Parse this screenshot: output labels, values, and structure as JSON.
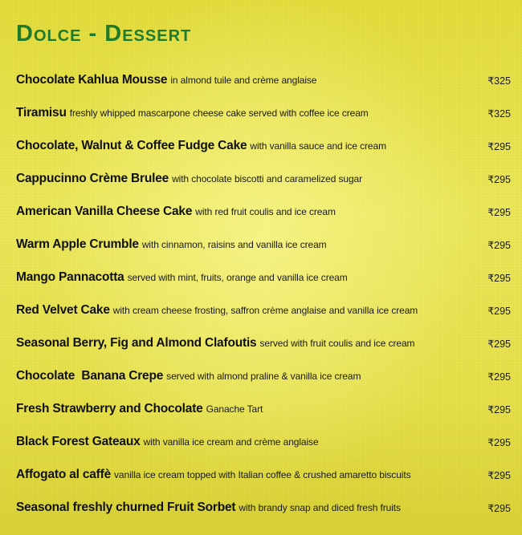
{
  "menu": {
    "title": "Dolce - Dessert",
    "items": [
      {
        "name": "Chocolate Kahlua Mousse",
        "description": "in almond tuile and crème anglaise",
        "price": "₹325"
      },
      {
        "name": "Tiramisu",
        "description": "freshly whipped mascarpone cheese cake served with coffee ice cream",
        "price": "₹325"
      },
      {
        "name": "Chocolate, Walnut & Coffee Fudge Cake",
        "description": "with vanilla sauce and ice cream",
        "price": "₹295"
      },
      {
        "name": "Cappucinno Crème Brulee",
        "description": "with chocolate biscotti and caramelized sugar",
        "price": "₹295"
      },
      {
        "name": "American Vanilla Cheese Cake",
        "description": "with red fruit coulis and ice cream",
        "price": "₹295"
      },
      {
        "name": "Warm Apple Crumble",
        "description": "with cinnamon, raisins and vanilla ice cream",
        "price": "₹295"
      },
      {
        "name": "Mango Pannacotta",
        "description": "served with mint, fruits, orange and vanilla ice cream",
        "price": "₹295"
      },
      {
        "name": "Red Velvet Cake",
        "description": "with cream cheese frosting, saffron crème anglaise and vanilla ice cream",
        "price": "₹295"
      },
      {
        "name": "Seasonal Berry, Fig and Almond Clafoutis",
        "description": "served with fruit coulis and ice cream",
        "price": "₹295"
      },
      {
        "name": "Chocolate  Banana Crepe",
        "description": "served with almond praline & vanilla ice cream",
        "price": "₹295"
      },
      {
        "name": "Fresh Strawberry and Chocolate",
        "description": "Ganache Tart",
        "price": "₹295"
      },
      {
        "name": "Black Forest Gateaux",
        "description": "with vanilla ice cream and crème anglaise",
        "price": "₹295"
      },
      {
        "name": "Affogato al caffè",
        "description": "vanilla ice cream topped with Italian coffee & crushed amaretto biscuits",
        "price": "₹295"
      },
      {
        "name": "Seasonal freshly churned Fruit Sorbet",
        "description": "with brandy snap and diced fresh fruits",
        "price": "₹295"
      }
    ]
  }
}
